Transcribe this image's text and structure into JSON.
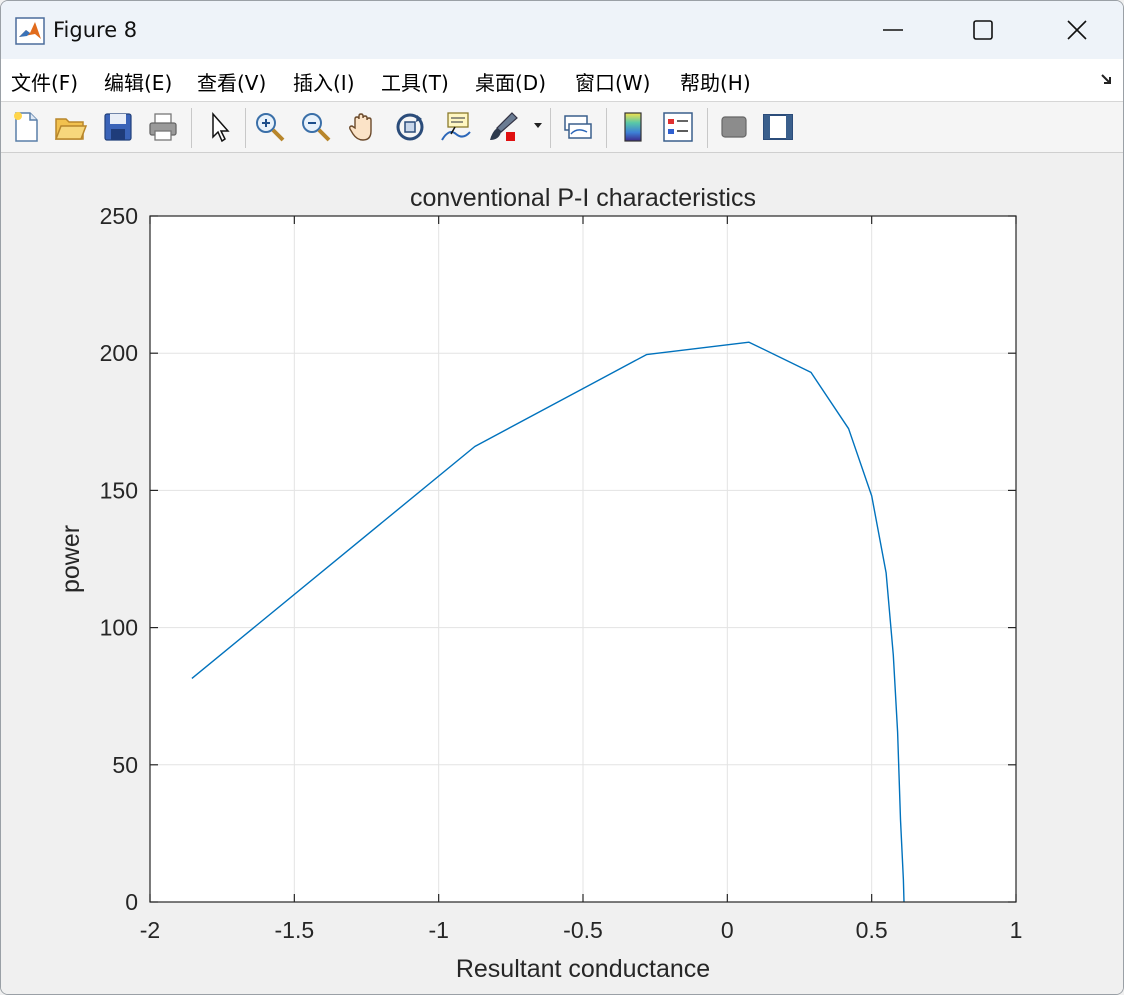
{
  "window": {
    "title": "Figure 8",
    "icon": "matlab-icon",
    "controls": [
      "minimize-icon",
      "maximize-icon",
      "close-icon"
    ]
  },
  "menu": {
    "items": [
      "文件(F)",
      "编辑(E)",
      "查看(V)",
      "插入(I)",
      "工具(T)",
      "桌面(D)",
      "窗口(W)",
      "帮助(H)"
    ]
  },
  "toolbar": {
    "icons": [
      "new-file-icon",
      "open-folder-icon",
      "save-icon",
      "print-icon",
      "select-arrow-icon",
      "zoom-in-icon",
      "zoom-out-icon",
      "pan-hand-icon",
      "rotate-3d-icon",
      "data-cursor-icon",
      "brush-icon",
      "brush-dropdown-icon",
      "link-plot-icon",
      "colorbar-icon",
      "legend-icon",
      "hide-plot-tools-icon",
      "show-plot-tools-icon"
    ]
  },
  "colors": {
    "line": "#0072bd",
    "grid": "#e3e3e3",
    "axis": "#262626",
    "plot_bg": "#ffffff",
    "figure_bg": "#f0f0f0"
  },
  "chart_data": {
    "type": "line",
    "title": "conventional P-I characteristics",
    "xlabel": "Resultant conductance",
    "ylabel": "power",
    "xlim": [
      -2,
      1
    ],
    "ylim": [
      0,
      250
    ],
    "xticks": [
      -2,
      -1.5,
      -1,
      -0.5,
      0,
      0.5,
      1
    ],
    "xtick_labels": [
      "-2",
      "-1.5",
      "-1",
      "-0.5",
      "0",
      "0.5",
      "1"
    ],
    "yticks": [
      0,
      50,
      100,
      150,
      200,
      250
    ],
    "ytick_labels": [
      "0",
      "50",
      "100",
      "150",
      "200",
      "250"
    ],
    "grid": true,
    "series": [
      {
        "x": [
          -1.855,
          -0.875,
          -0.28,
          0.075,
          0.29,
          0.42,
          0.5,
          0.55,
          0.575,
          0.59,
          0.6,
          0.61,
          0.612
        ],
        "y": [
          81.5,
          166,
          199.5,
          204,
          193,
          172.5,
          148,
          120,
          90,
          62,
          30,
          8,
          0
        ]
      }
    ]
  }
}
